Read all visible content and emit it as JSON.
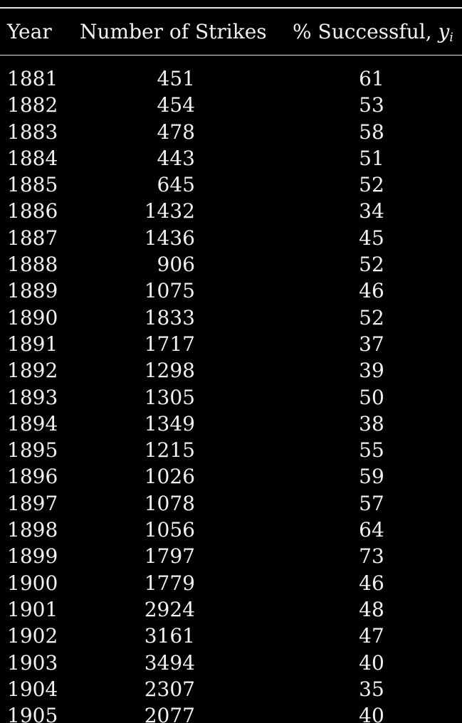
{
  "table": {
    "headers": {
      "year": "Year",
      "strikes": "Number of Strikes",
      "success_prefix": "% Successful, ",
      "success_var": "y",
      "success_sub": "i"
    },
    "rows": [
      {
        "year": "1881",
        "strikes": "451",
        "success": "61"
      },
      {
        "year": "1882",
        "strikes": "454",
        "success": "53"
      },
      {
        "year": "1883",
        "strikes": "478",
        "success": "58"
      },
      {
        "year": "1884",
        "strikes": "443",
        "success": "51"
      },
      {
        "year": "1885",
        "strikes": "645",
        "success": "52"
      },
      {
        "year": "1886",
        "strikes": "1432",
        "success": "34"
      },
      {
        "year": "1887",
        "strikes": "1436",
        "success": "45"
      },
      {
        "year": "1888",
        "strikes": "906",
        "success": "52"
      },
      {
        "year": "1889",
        "strikes": "1075",
        "success": "46"
      },
      {
        "year": "1890",
        "strikes": "1833",
        "success": "52"
      },
      {
        "year": "1891",
        "strikes": "1717",
        "success": "37"
      },
      {
        "year": "1892",
        "strikes": "1298",
        "success": "39"
      },
      {
        "year": "1893",
        "strikes": "1305",
        "success": "50"
      },
      {
        "year": "1894",
        "strikes": "1349",
        "success": "38"
      },
      {
        "year": "1895",
        "strikes": "1215",
        "success": "55"
      },
      {
        "year": "1896",
        "strikes": "1026",
        "success": "59"
      },
      {
        "year": "1897",
        "strikes": "1078",
        "success": "57"
      },
      {
        "year": "1898",
        "strikes": "1056",
        "success": "64"
      },
      {
        "year": "1899",
        "strikes": "1797",
        "success": "73"
      },
      {
        "year": "1900",
        "strikes": "1779",
        "success": "46"
      },
      {
        "year": "1901",
        "strikes": "2924",
        "success": "48"
      },
      {
        "year": "1902",
        "strikes": "3161",
        "success": "47"
      },
      {
        "year": "1903",
        "strikes": "3494",
        "success": "40"
      },
      {
        "year": "1904",
        "strikes": "2307",
        "success": "35"
      },
      {
        "year": "1905",
        "strikes": "2077",
        "success": "40"
      }
    ]
  }
}
